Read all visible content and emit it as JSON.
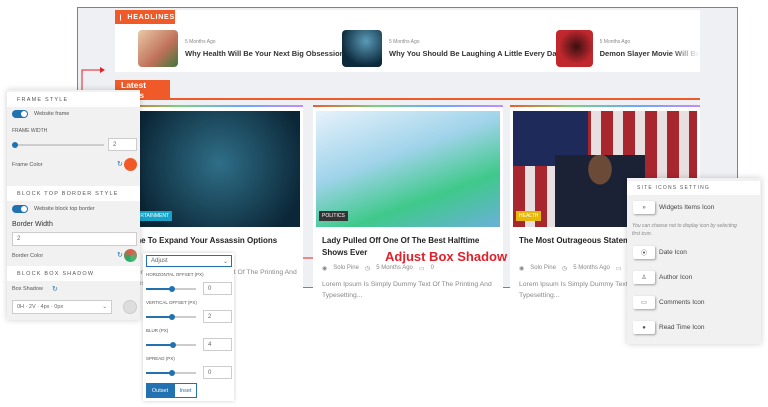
{
  "colors": {
    "accent": "#f05a28",
    "frame": "#f05a28",
    "annotation": "#e0202a",
    "control": "#2271b1"
  },
  "headlines": {
    "label": "HEADLINES",
    "items": [
      {
        "ago": "5 Months Ago",
        "title": "Why Health Will Be Your Next Big Obsession"
      },
      {
        "ago": "5 Months Ago",
        "title": "Why You Should Be Laughing A Little Every Day"
      },
      {
        "ago": "5 Months Ago",
        "title": "Demon Slayer Movie Will Be"
      }
    ]
  },
  "latest": {
    "label": "Latest Posts"
  },
  "cards": [
    {
      "category": "ENTERTAINMENT",
      "title": "Time To Expand Your Assassin Options",
      "excerpt": "Lorem Ipsum Is Simply Dummy Text Of The Printing And Typesetting Of The Printing The"
    },
    {
      "category": "POLITICS",
      "title": "Lady Pulled Off One Of The Best Halftime Shows Ever",
      "author": "Solo Pine",
      "ago": "5 Months Ago",
      "comments": "0",
      "excerpt": "Lorem Ipsum Is Simply Dummy Text Of The Printing And Typesetting..."
    },
    {
      "category": "HEALTH",
      "title": "The Most Outrageous Statement Obama",
      "author": "Solo Pine",
      "ago": "5 Months Ago",
      "comments": "0",
      "excerpt": "Lorem Ipsum Is Simply Dummy Text Of The Printing And Typesetting..."
    }
  ],
  "left_panel": {
    "frame_style": "FRAME STYLE",
    "website_frame": "Website frame",
    "frame_width_label": "FRAME WIDTH",
    "frame_width": "2",
    "frame_color_label": "Frame Color",
    "frame_color": "#f05a28",
    "block_top": "BLOCK TOP BORDER STYLE",
    "website_block_top": "Website block top border",
    "border_width_label": "Border Width",
    "border_width": "2",
    "border_color_label": "Border Color",
    "box_shadow_section": "BLOCK BOX SHADOW",
    "box_shadow_label": "Box Shadow",
    "box_shadow_value": "0H · 2V · 4px · 0px"
  },
  "shadow_popup": {
    "select": "Adjust",
    "h_label": "HORIZONTAL OFFSET (PX)",
    "h": "0",
    "v_label": "VERTICAL OFFSET (PX)",
    "v": "2",
    "blur_label": "BLUR (PX)",
    "blur": "4",
    "spread_label": "SPREAD (PX)",
    "spread": "0",
    "outset": "Outset",
    "inset": "Inset",
    "selected": "Outset"
  },
  "annotation": "Adjust Box Shadow",
  "right_panel": {
    "title": "SITE ICONS SETTING",
    "widgets": "Widgets Items Icon",
    "hint": "You can choose not to display icon by selecting first icon.",
    "date": "Date Icon",
    "author": "Author Icon",
    "comments": "Comments Icon",
    "read_time": "Read Time Icon"
  }
}
